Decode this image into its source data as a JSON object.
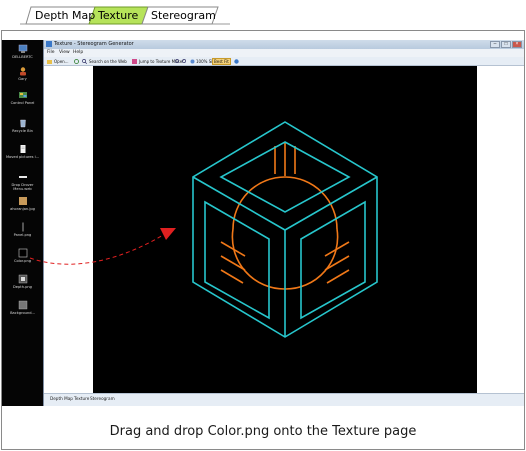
{
  "tabs": [
    {
      "label": "Depth Map",
      "active": false
    },
    {
      "label": "Texture",
      "active": true
    },
    {
      "label": "Stereogram",
      "active": false
    }
  ],
  "colors": {
    "active_tab": "#b6e35a",
    "cube_outline": "#27c6cc",
    "inner_lines": "#f07818",
    "arrow": "#e02020",
    "texture_bg": "#000000"
  },
  "desktop": {
    "icons": [
      {
        "name": "computer-icon",
        "label": "DELLBERTC"
      },
      {
        "name": "user-folder-icon",
        "label": "Gary"
      },
      {
        "name": "control-panel-icon",
        "label": "Control Panel"
      },
      {
        "name": "recycle-bin-icon",
        "label": "Recycle Bin"
      },
      {
        "name": "document-icon",
        "label": "Moved pictures i..."
      },
      {
        "name": "shortcut-icon",
        "label": "Drop Drover Menu.web"
      },
      {
        "name": "image-icon",
        "label": "ahoranjan.jpg"
      },
      {
        "name": "image-icon",
        "label": "Panel.png"
      },
      {
        "name": "image-icon",
        "label": "Color.png"
      },
      {
        "name": "image-icon",
        "label": "Depth.png"
      },
      {
        "name": "image-icon",
        "label": "Background..."
      }
    ]
  },
  "app": {
    "title": "Texture - Stereogram Generator",
    "menu": [
      "File",
      "View",
      "Help"
    ],
    "toolbar": {
      "open": "Open...",
      "search": "Search on the Web",
      "jump": "Jump to Texture Maker",
      "zoom": "100% Size",
      "best_fit": "Best Fit"
    },
    "bottom_tabs": [
      "Depth Map",
      "Texture",
      "Stereogram"
    ]
  },
  "caption": "Drag and drop Color.png onto the Texture page"
}
